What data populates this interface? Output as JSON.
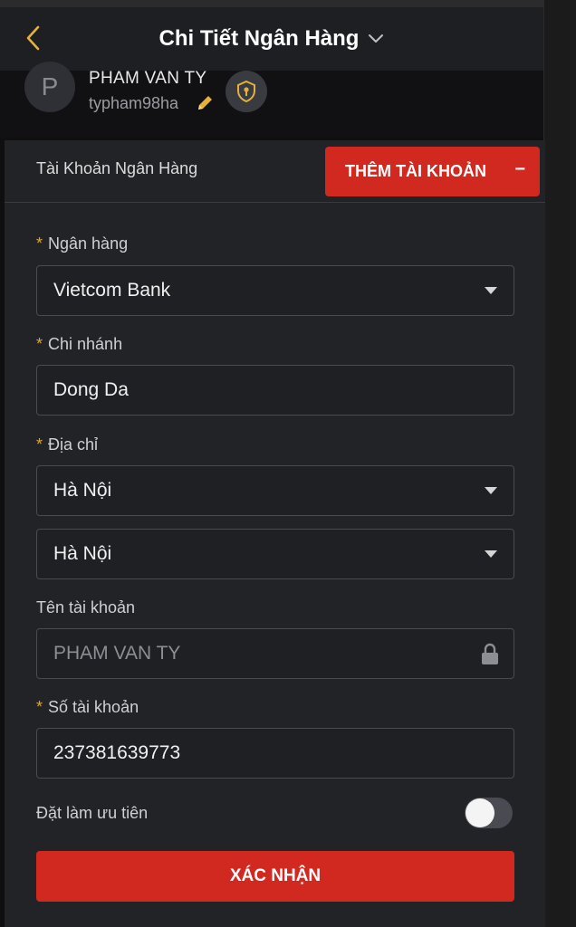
{
  "header": {
    "title": "Chi Tiết Ngân Hàng"
  },
  "profile": {
    "avatar_letter": "P",
    "name": "PHAM VAN TY",
    "username": "typham98ha"
  },
  "bank_section": {
    "title": "Tài Khoản Ngân Hàng",
    "add_button": "THÊM TÀI KHOẢN",
    "add_button_icon": "−"
  },
  "form": {
    "bank": {
      "label": "Ngân hàng",
      "value": "Vietcom Bank"
    },
    "branch": {
      "label": "Chi nhánh",
      "value": "Dong Da"
    },
    "address": {
      "label": "Địa chỉ",
      "province": "Hà Nội",
      "district": "Hà Nội"
    },
    "account_name": {
      "label": "Tên tài khoản",
      "value": "PHAM VAN TY"
    },
    "account_number": {
      "label": "Số tài khoản",
      "value": "237381639773"
    },
    "required_mark": "*",
    "priority": {
      "label": "Đặt làm ưu tiên",
      "on": false
    },
    "confirm_label": "XÁC NHẬN"
  },
  "colors": {
    "accent": "#d1281f",
    "required": "#e2a72b",
    "gold": "#e2b23a"
  },
  "icons": [
    "back-arrow-icon",
    "chevron-down-icon",
    "pencil-icon",
    "shield-icon",
    "caret-down-icon",
    "lock-icon"
  ]
}
